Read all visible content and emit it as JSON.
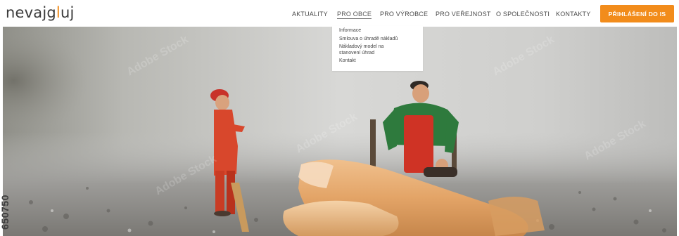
{
  "brand": {
    "logo_text_before": "nevajg",
    "logo_text_accent": "l",
    "logo_text_after": "uj"
  },
  "nav": {
    "items": [
      {
        "label": "AKTUALITY",
        "active": false
      },
      {
        "label": "PRO OBCE",
        "active": true
      },
      {
        "label": "PRO VÝROBCE",
        "active": false
      },
      {
        "label": "PRO VEŘEJNOST",
        "active": false
      },
      {
        "label": "O SPOLEČNOSTI",
        "active": false
      },
      {
        "label": "KONTAKTY",
        "active": false
      }
    ],
    "login_label": "PŘIHLÁŠENÍ DO IS"
  },
  "dropdown": {
    "items": [
      "Informace",
      "Smlouva o úhradě nákladů",
      "Nákladový model na",
      "stanovení úhrad",
      "Kontakt"
    ]
  },
  "hero": {
    "stock_id": "650750"
  },
  "colors": {
    "accent": "#f28c1b",
    "text": "#4a4a4a",
    "background": "#ffffff"
  },
  "icons": [
    "logo"
  ]
}
